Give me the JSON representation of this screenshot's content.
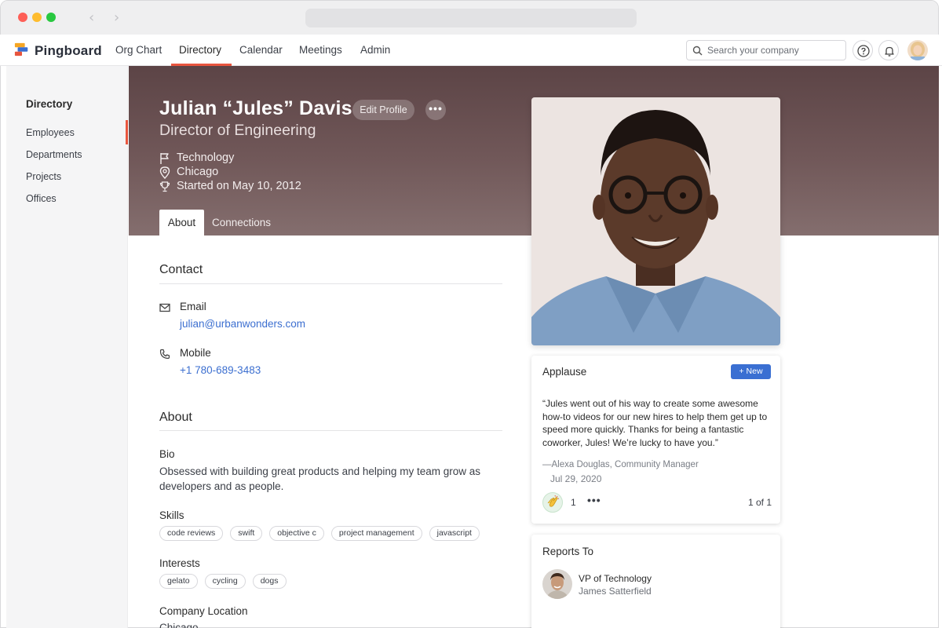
{
  "colors": {
    "accent": "#e8553e",
    "link": "#3c6fd0",
    "primary_button": "#3a6fd2",
    "hero_bg": "#6a5152"
  },
  "header": {
    "brand": "Pingboard",
    "nav": [
      "Org Chart",
      "Directory",
      "Calendar",
      "Meetings",
      "Admin"
    ],
    "active_nav": "Directory",
    "search_placeholder": "Search your company",
    "icons": [
      "help-icon",
      "bell-icon",
      "user-avatar"
    ]
  },
  "sidebar": {
    "title": "Directory",
    "items": [
      "Employees",
      "Departments",
      "Projects",
      "Offices"
    ],
    "active_item": "Employees"
  },
  "profile": {
    "name": "Julian “Jules” Davis",
    "edit_label": "Edit Profile",
    "more_label": "•••",
    "title": "Director of Engineering",
    "department": "Technology",
    "location": "Chicago",
    "start": "Started on May 10, 2012",
    "tabs": [
      "About",
      "Connections"
    ],
    "active_tab": "About"
  },
  "contact": {
    "heading": "Contact",
    "email_label": "Email",
    "email": "julian@urbanwonders.com",
    "mobile_label": "Mobile",
    "mobile": "+1 780-689-3483"
  },
  "about": {
    "heading": "About",
    "bio_label": "Bio",
    "bio": "Obsessed with building great products and helping my team grow as developers and as people.",
    "skills_label": "Skills",
    "skills": [
      "code reviews",
      "swift",
      "objective c",
      "project management",
      "javascript"
    ],
    "interests_label": "Interests",
    "interests": [
      "gelato",
      "cycling",
      "dogs"
    ],
    "location_label": "Company Location",
    "location_value": "Chicago"
  },
  "applause": {
    "title": "Applause",
    "new_label": "+ New",
    "quote": "“Jules went out of his way to create some awesome how-to videos for our new hires to help them get up to speed more quickly. Thanks for being a fantastic coworker, Jules! We’re lucky to have you.”",
    "author": "—Alexa Douglas, Community Manager",
    "date": "Jul 29, 2020",
    "claps": "1",
    "more_label": "•••",
    "pager": "1 of 1"
  },
  "reports_to": {
    "title": "Reports To",
    "role": "VP of Technology",
    "name": "James Satterfield"
  }
}
